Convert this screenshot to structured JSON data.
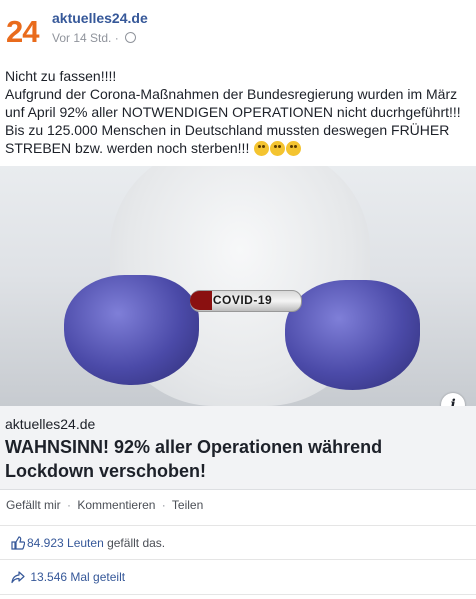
{
  "header": {
    "logo_text": "24",
    "page_name": "aktuelles24.de",
    "timestamp": "Vor 14 Std.",
    "meta_separator": "·"
  },
  "post": {
    "lines": [
      "Nicht zu fassen!!!!",
      "Aufgrund der Corona-Maßnahmen der Bundesregierung wurden im März",
      "unf April 92% aller NOTWENDIGEN OPERATIONEN nicht ducrhgeführt!!!",
      "Bis zu 125.000 Menschen in Deutschland mussten deswegen FRÜHER",
      "STREBEN bzw. werden noch sterben!!!"
    ],
    "emojis": [
      "flushed-face-icon",
      "screaming-face-icon",
      "exploding-head-icon"
    ]
  },
  "image": {
    "tube_label": "COVID-19",
    "info_icon_glyph": "i"
  },
  "link_preview": {
    "domain": "aktuelles24.de",
    "title_line1": "WAHNSINN! 92% aller Operationen während",
    "title_line2": "Lockdown verschoben!"
  },
  "actions": {
    "like": "Gefällt mir",
    "comment": "Kommentieren",
    "share": "Teilen",
    "separator": "·"
  },
  "stats": {
    "likes_count": "84.923 Leuten",
    "likes_suffix": " gefällt das.",
    "shares": "13.546 Mal geteilt"
  },
  "colors": {
    "brand_link": "#365899",
    "logo": "#e96b1c"
  }
}
